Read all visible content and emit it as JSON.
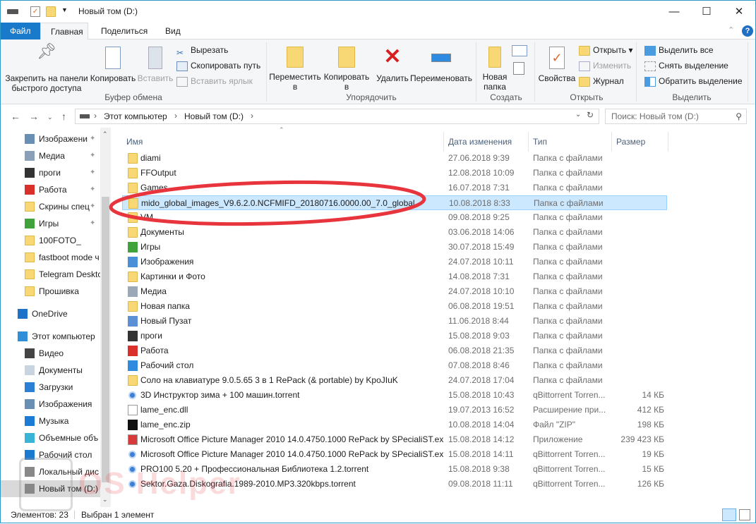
{
  "window": {
    "title": "Новый том (D:)",
    "controls": {
      "minimize": "—",
      "maximize": "☐",
      "close": "✕"
    }
  },
  "tabs": [
    "Файл",
    "Главная",
    "Поделиться",
    "Вид"
  ],
  "ribbon": {
    "clipboard": {
      "pin": "Закрепить на панели быстрого доступа",
      "copy": "Копировать",
      "paste": "Вставить",
      "cut": "Вырезать",
      "copy_path": "Скопировать путь",
      "paste_shortcut": "Вставить ярлык",
      "label": "Буфер обмена"
    },
    "organize": {
      "move": "Переместить в",
      "copy_to": "Копировать в",
      "delete": "Удалить",
      "rename": "Переименовать",
      "label": "Упорядочить"
    },
    "new": {
      "new_folder": "Новая папка",
      "label": "Создать"
    },
    "open": {
      "properties": "Свойства",
      "open": "Открыть",
      "edit": "Изменить",
      "history": "Журнал",
      "label": "Открыть"
    },
    "select": {
      "select_all": "Выделить все",
      "select_none": "Снять выделение",
      "invert": "Обратить выделение",
      "label": "Выделить"
    }
  },
  "address": {
    "path": [
      "Этот компьютер",
      "Новый том (D:)"
    ],
    "search_placeholder": "Поиск: Новый том (D:)"
  },
  "nav": [
    {
      "label": "Изображени",
      "icon": "pictures-icon",
      "pinned": true,
      "color": "#6a8fb5"
    },
    {
      "label": "Медиа",
      "icon": "media-icon",
      "pinned": true,
      "color": "#8aa0b8"
    },
    {
      "label": "проги",
      "icon": "film-folder-icon",
      "pinned": true,
      "color": "#333333"
    },
    {
      "label": "Работа",
      "icon": "work-folder-icon",
      "pinned": true,
      "color": "#d9302c"
    },
    {
      "label": "Скрины спец",
      "icon": "folder-icon",
      "pinned": true,
      "color": "#f8d775"
    },
    {
      "label": "Игры",
      "icon": "games-icon",
      "pinned": true,
      "color": "#3fa23a"
    },
    {
      "label": "100FOTO_",
      "icon": "folder-icon",
      "color": "#f8d775"
    },
    {
      "label": "fastboot mode ч",
      "icon": "folder-icon",
      "color": "#f8d775"
    },
    {
      "label": "Telegram Desktc",
      "icon": "folder-icon",
      "color": "#f8d775"
    },
    {
      "label": "Прошивка",
      "icon": "folder-icon",
      "color": "#f8d775"
    },
    {
      "label": "OneDrive",
      "icon": "onedrive-icon",
      "root": true,
      "color": "#1b72c8"
    },
    {
      "label": "Этот компьютер",
      "icon": "computer-icon",
      "root": true,
      "color": "#2f8fd8"
    },
    {
      "label": "Видео",
      "icon": "video-icon",
      "color": "#444444"
    },
    {
      "label": "Документы",
      "icon": "documents-icon",
      "color": "#c8d4e0"
    },
    {
      "label": "Загрузки",
      "icon": "downloads-icon",
      "color": "#2b7fd4"
    },
    {
      "label": "Изображения",
      "icon": "pictures-icon",
      "color": "#6a8fb5"
    },
    {
      "label": "Музыка",
      "icon": "music-icon",
      "color": "#1c7cd5"
    },
    {
      "label": "Объемные объ",
      "icon": "3d-objects-icon",
      "color": "#39b3d6"
    },
    {
      "label": "Рабочий стол",
      "icon": "desktop-icon",
      "color": "#1a7ad0"
    },
    {
      "label": "Локальный дис",
      "icon": "drive-icon",
      "color": "#888888"
    },
    {
      "label": "Новый том (D:)",
      "icon": "drive-icon",
      "selected": true,
      "color": "#888888"
    }
  ],
  "columns": {
    "name": "Имя",
    "date": "Дата изменения",
    "type": "Тип",
    "size": "Размер"
  },
  "files": [
    {
      "name": "diami",
      "date": "27.06.2018 9:39",
      "type": "Папка с файлами",
      "size": "",
      "icon": "folder"
    },
    {
      "name": "FFOutput",
      "date": "12.08.2018 10:09",
      "type": "Папка с файлами",
      "size": "",
      "icon": "folder"
    },
    {
      "name": "Games",
      "date": "16.07.2018 7:31",
      "type": "Папка с файлами",
      "size": "",
      "icon": "folder"
    },
    {
      "name": "mido_global_images_V9.6.2.0.NCFMIFD_20180716.0000.00_7.0_global",
      "date": "10.08.2018 8:33",
      "type": "Папка с файлами",
      "size": "",
      "icon": "folder",
      "selected": true
    },
    {
      "name": "VM",
      "date": "09.08.2018 9:25",
      "type": "Папка с файлами",
      "size": "",
      "icon": "folder"
    },
    {
      "name": "Документы",
      "date": "03.06.2018 14:06",
      "type": "Папка с файлами",
      "size": "",
      "icon": "folder"
    },
    {
      "name": "Игры",
      "date": "30.07.2018 15:49",
      "type": "Папка с файлами",
      "size": "",
      "icon": "games"
    },
    {
      "name": "Изображения",
      "date": "24.07.2018 10:11",
      "type": "Папка с файлами",
      "size": "",
      "icon": "pictures"
    },
    {
      "name": "Картинки и Фото",
      "date": "14.08.2018 7:31",
      "type": "Папка с файлами",
      "size": "",
      "icon": "folder"
    },
    {
      "name": "Медиа",
      "date": "24.07.2018 10:10",
      "type": "Папка с файлами",
      "size": "",
      "icon": "media"
    },
    {
      "name": "Новая папка",
      "date": "06.08.2018 19:51",
      "type": "Папка с файлами",
      "size": "",
      "icon": "folder"
    },
    {
      "name": "Новый Пузат",
      "date": "11.06.2018 8:44",
      "type": "Папка с файлами",
      "size": "",
      "icon": "user"
    },
    {
      "name": "проги",
      "date": "15.08.2018 9:03",
      "type": "Папка с файлами",
      "size": "",
      "icon": "film"
    },
    {
      "name": "Работа",
      "date": "06.08.2018 21:35",
      "type": "Папка с файлами",
      "size": "",
      "icon": "work"
    },
    {
      "name": "Рабочий стол",
      "date": "07.08.2018 8:46",
      "type": "Папка с файлами",
      "size": "",
      "icon": "desktop"
    },
    {
      "name": "Соло на клавиатуре 9.0.5.65 3 в 1 RePack (& portable) by KpoJIuK",
      "date": "24.07.2018 17:04",
      "type": "Папка с файлами",
      "size": "",
      "icon": "folder"
    },
    {
      "name": "3D Инструктор зима + 100 машин.torrent",
      "date": "15.08.2018 10:43",
      "type": "qBittorrent Torren...",
      "size": "14 КБ",
      "icon": "torrent"
    },
    {
      "name": "lame_enc.dll",
      "date": "19.07.2013 16:52",
      "type": "Расширение при...",
      "size": "412 КБ",
      "icon": "dll"
    },
    {
      "name": "lame_enc.zip",
      "date": "10.08.2018 14:04",
      "type": "Файл \"ZIP\"",
      "size": "198 КБ",
      "icon": "7z"
    },
    {
      "name": "Microsoft Office Picture Manager 2010 14.0.4750.1000 RePack by SPecialiST.exe",
      "date": "15.08.2018 14:12",
      "type": "Приложение",
      "size": "239 423 КБ",
      "icon": "exe"
    },
    {
      "name": "Microsoft Office Picture Manager 2010 14.0.4750.1000 RePack by SPecialiST.ex...",
      "date": "15.08.2018 14:11",
      "type": "qBittorrent Torren...",
      "size": "19 КБ",
      "icon": "torrent"
    },
    {
      "name": "PRO100 5.20 + Профессиональная Библиотека 1.2.torrent",
      "date": "15.08.2018 9:38",
      "type": "qBittorrent Torren...",
      "size": "15 КБ",
      "icon": "torrent"
    },
    {
      "name": "Sektor.Gaza.Diskografia.1989-2010.MP3.320kbps.torrent",
      "date": "09.08.2018 11:11",
      "type": "qBittorrent Torren...",
      "size": "126 КБ",
      "icon": "torrent"
    }
  ],
  "status": {
    "count": "Элементов: 23",
    "selected": "Выбран 1 элемент"
  },
  "watermark": "OS Helper",
  "colors": {
    "accent": "#1979ca",
    "selection": "#cce8ff",
    "annotation": "#e8343c"
  }
}
